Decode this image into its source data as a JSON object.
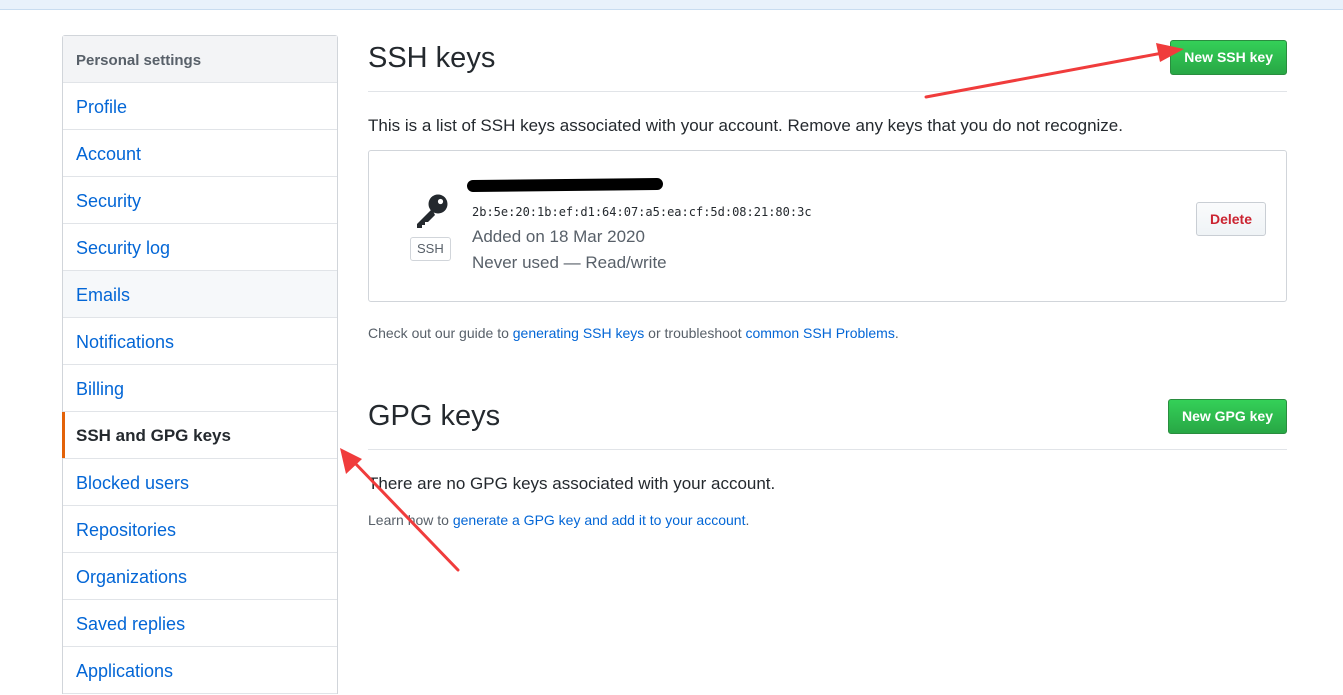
{
  "sidebar": {
    "header": "Personal settings",
    "items": [
      {
        "label": "Profile"
      },
      {
        "label": "Account"
      },
      {
        "label": "Security"
      },
      {
        "label": "Security log"
      },
      {
        "label": "Emails"
      },
      {
        "label": "Notifications"
      },
      {
        "label": "Billing"
      },
      {
        "label": "SSH and GPG keys"
      },
      {
        "label": "Blocked users"
      },
      {
        "label": "Repositories"
      },
      {
        "label": "Organizations"
      },
      {
        "label": "Saved replies"
      },
      {
        "label": "Applications"
      }
    ],
    "selected": "SSH and GPG keys",
    "hovered": "Emails"
  },
  "ssh": {
    "title": "SSH keys",
    "new_button": "New SSH key",
    "intro": "This is a list of SSH keys associated with your account. Remove any keys that you do not recognize.",
    "key": {
      "type_label": "SSH",
      "fingerprint": "2b:5e:20:1b:ef:d1:64:07:a5:ea:cf:5d:08:21:80:3c",
      "added": "Added on 18 Mar 2020",
      "usage": "Never used — Read/write",
      "delete_label": "Delete"
    },
    "help": {
      "prefix": "Check out our guide to ",
      "link1": "generating SSH keys",
      "middle": " or troubleshoot ",
      "link2": "common SSH Problems",
      "suffix": "."
    }
  },
  "gpg": {
    "title": "GPG keys",
    "new_button": "New GPG key",
    "empty": "There are no GPG keys associated with your account.",
    "help": {
      "prefix": "Learn how to ",
      "link": "generate a GPG key and add it to your account",
      "suffix": "."
    }
  },
  "colors": {
    "link": "#0366d6",
    "green": "#28a745",
    "danger": "#cb2431",
    "selected_marker": "#e36209",
    "annotation_arrow": "#f03c3c"
  }
}
